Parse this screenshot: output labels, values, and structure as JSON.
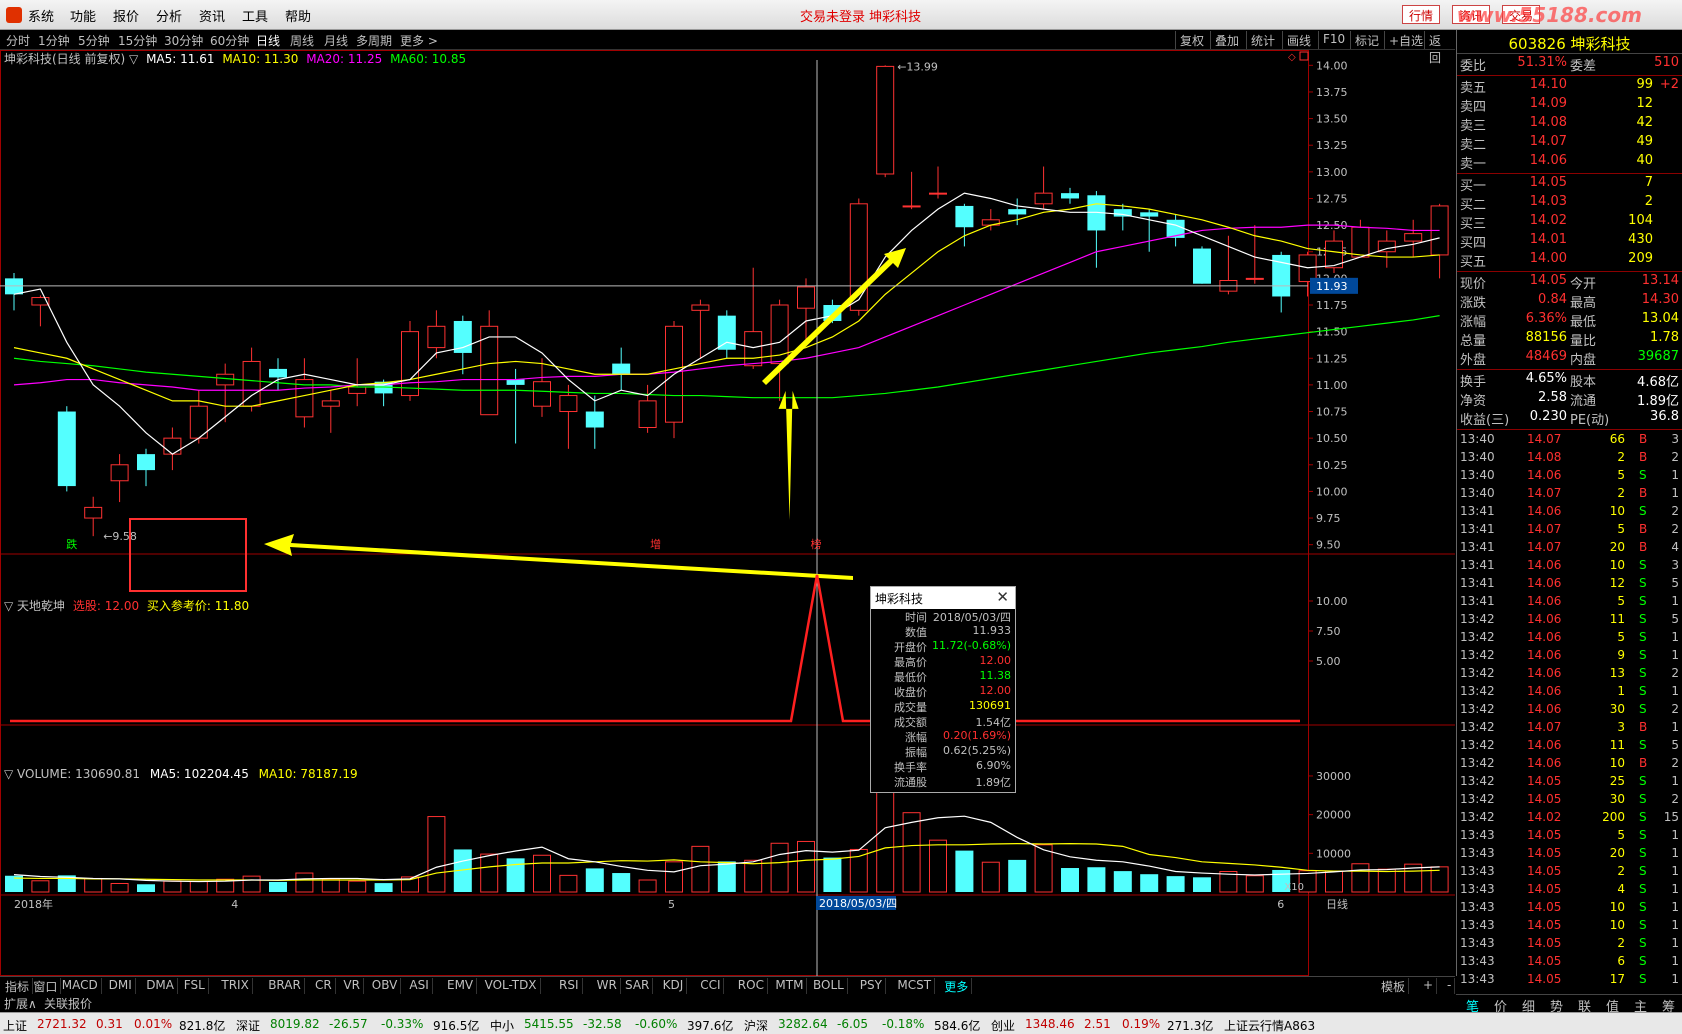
{
  "app": {
    "menu": [
      "系统",
      "功能",
      "报价",
      "分析",
      "资讯",
      "工具",
      "帮助"
    ],
    "center_title": "交易未登录  坤彩科技",
    "right_buttons": [
      "行情",
      "资讯",
      "交易"
    ],
    "watermark": "www.55188.com"
  },
  "toolbar": {
    "periods": [
      "分时",
      "1分钟",
      "5分钟",
      "15分钟",
      "30分钟",
      "60分钟",
      "日线",
      "周线",
      "月线",
      "多周期",
      "更多 >"
    ],
    "active_period": "日线",
    "right_items": [
      "复权",
      "叠加",
      "统计",
      "画线",
      "F10",
      "标记",
      "+自选",
      "返回"
    ]
  },
  "main_chart": {
    "header_name": "坤彩科技(日线 前复权) ▽",
    "ma_labels": [
      {
        "text": "MA5: 11.61",
        "color": "#ffffff"
      },
      {
        "text": "MA10: 11.30",
        "color": "#ffff00"
      },
      {
        "text": "MA20: 11.25",
        "color": "#ff00ff"
      },
      {
        "text": "MA60: 10.85",
        "color": "#00ff00"
      }
    ],
    "y_ticks": [
      "14.00",
      "13.75",
      "13.50",
      "13.25",
      "13.00",
      "12.75",
      "12.50",
      "12.25",
      "12.00",
      "11.75",
      "11.50",
      "11.25",
      "11.00",
      "10.75",
      "10.50",
      "10.25",
      "10.00",
      "9.75",
      "9.50"
    ],
    "y_range": [
      9.45,
      14.05
    ],
    "cursor_price": "11.93",
    "high_label": "13.99",
    "low_label": "9.58",
    "markers": [
      "跌",
      "增",
      "榜"
    ],
    "candles": [
      [
        12.0,
        11.85,
        12.05,
        11.7
      ],
      [
        11.75,
        11.82,
        11.84,
        11.55
      ],
      [
        10.75,
        10.05,
        10.8,
        10.0
      ],
      [
        9.75,
        9.85,
        9.95,
        9.58
      ],
      [
        10.1,
        10.25,
        10.35,
        9.9
      ],
      [
        10.35,
        10.2,
        10.4,
        10.05
      ],
      [
        10.35,
        10.5,
        10.6,
        10.2
      ],
      [
        10.5,
        10.8,
        10.95,
        10.45
      ],
      [
        11.0,
        11.1,
        11.2,
        10.65
      ],
      [
        10.8,
        11.22,
        11.35,
        10.75
      ],
      [
        11.15,
        11.07,
        11.25,
        10.95
      ],
      [
        10.7,
        11.05,
        11.25,
        10.6
      ],
      [
        10.8,
        10.85,
        10.95,
        10.55
      ],
      [
        10.92,
        10.98,
        11.25,
        10.8
      ],
      [
        11.03,
        10.92,
        11.05,
        10.8
      ],
      [
        10.9,
        11.5,
        11.6,
        10.85
      ],
      [
        11.35,
        11.55,
        11.7,
        11.25
      ],
      [
        11.6,
        11.3,
        11.65,
        11.1
      ],
      [
        10.72,
        11.55,
        11.7,
        10.95
      ],
      [
        11.05,
        11.0,
        11.15,
        10.45
      ],
      [
        10.8,
        11.03,
        11.25,
        10.7
      ],
      [
        10.75,
        10.9,
        11.0,
        10.4
      ],
      [
        10.75,
        10.6,
        10.9,
        10.4
      ],
      [
        11.2,
        11.1,
        11.35,
        10.95
      ],
      [
        10.6,
        10.85,
        11.0,
        10.55
      ],
      [
        10.65,
        11.55,
        11.6,
        10.5
      ],
      [
        11.7,
        11.75,
        11.8,
        11.25
      ],
      [
        11.65,
        11.33,
        11.7,
        11.25
      ],
      [
        11.18,
        11.5,
        12.1,
        11.15
      ],
      [
        11.2,
        11.75,
        11.8,
        10.85
      ],
      [
        11.72,
        11.92,
        12.0,
        11.38
      ],
      [
        11.75,
        11.6,
        11.8,
        11.58
      ],
      [
        11.7,
        12.7,
        12.75,
        11.65
      ],
      [
        12.98,
        13.99,
        14.0,
        12.95
      ],
      [
        12.68,
        12.68,
        13.0,
        12.65
      ],
      [
        12.8,
        12.8,
        13.05,
        12.75
      ],
      [
        12.68,
        12.48,
        12.7,
        12.3
      ],
      [
        12.5,
        12.55,
        12.65,
        12.45
      ],
      [
        12.65,
        12.6,
        12.75,
        12.5
      ],
      [
        12.7,
        12.8,
        13.05,
        12.65
      ],
      [
        12.8,
        12.75,
        12.85,
        12.7
      ],
      [
        12.78,
        12.45,
        12.82,
        12.1
      ],
      [
        12.65,
        12.58,
        12.7,
        12.45
      ],
      [
        12.62,
        12.58,
        12.65,
        12.25
      ],
      [
        12.55,
        12.38,
        12.6,
        12.3
      ],
      [
        12.28,
        11.95,
        12.3,
        11.95
      ],
      [
        11.88,
        11.98,
        12.4,
        11.85
      ],
      [
        12.0,
        12.0,
        12.5,
        11.95
      ],
      [
        12.22,
        11.83,
        12.25,
        11.68
      ],
      [
        11.97,
        12.22,
        12.25,
        11.83
      ],
      [
        12.1,
        12.35,
        12.45,
        12.05
      ],
      [
        12.2,
        12.48,
        12.55,
        12.2
      ],
      [
        12.25,
        12.35,
        12.45,
        12.1
      ],
      [
        12.35,
        12.42,
        12.55,
        12.2
      ],
      [
        12.22,
        12.68,
        12.7,
        12.0
      ]
    ],
    "ma5": [
      11.85,
      11.9,
      11.4,
      11.0,
      10.8,
      10.55,
      10.35,
      10.5,
      10.7,
      10.9,
      11.05,
      11.1,
      11.05,
      11.0,
      11.0,
      11.05,
      11.3,
      11.35,
      11.45,
      11.45,
      11.3,
      11.05,
      10.85,
      10.95,
      10.9,
      11.1,
      11.25,
      11.4,
      11.35,
      11.4,
      11.6,
      11.65,
      11.8,
      12.2,
      12.45,
      12.65,
      12.8,
      12.75,
      12.68,
      12.65,
      12.62,
      12.62,
      12.6,
      12.55,
      12.5,
      12.4,
      12.3,
      12.2,
      12.15,
      12.1,
      12.12,
      12.2,
      12.28,
      12.32,
      12.38
    ],
    "ma10": [
      11.35,
      11.3,
      11.25,
      11.15,
      11.05,
      10.95,
      10.85,
      10.85,
      10.8,
      10.8,
      10.85,
      10.9,
      10.95,
      11.0,
      11.02,
      11.05,
      11.1,
      11.15,
      11.2,
      11.22,
      11.2,
      11.15,
      11.1,
      11.1,
      11.1,
      11.15,
      11.2,
      11.25,
      11.25,
      11.28,
      11.35,
      11.45,
      11.6,
      11.85,
      12.05,
      12.25,
      12.4,
      12.5,
      12.55,
      12.62,
      12.65,
      12.7,
      12.68,
      12.65,
      12.6,
      12.55,
      12.48,
      12.4,
      12.35,
      12.28,
      12.25,
      12.22,
      12.2,
      12.2,
      12.22
    ],
    "ma20": [
      11.0,
      11.02,
      11.05,
      11.05,
      11.02,
      11.0,
      10.98,
      10.95,
      10.95,
      10.95,
      10.95,
      10.97,
      10.98,
      11.0,
      11.0,
      11.02,
      11.03,
      11.05,
      11.05,
      11.05,
      11.07,
      11.08,
      11.08,
      11.1,
      11.1,
      11.12,
      11.15,
      11.18,
      11.2,
      11.22,
      11.25,
      11.3,
      11.35,
      11.45,
      11.55,
      11.65,
      11.75,
      11.85,
      11.95,
      12.05,
      12.15,
      12.25,
      12.3,
      12.35,
      12.4,
      12.45,
      12.47,
      12.48,
      12.48,
      12.5,
      12.5,
      12.48,
      12.47,
      12.45,
      12.45
    ],
    "ma60": [
      11.25,
      11.22,
      11.2,
      11.18,
      11.15,
      11.12,
      11.1,
      11.08,
      11.06,
      11.04,
      11.02,
      11.0,
      11.0,
      10.98,
      10.98,
      10.97,
      10.96,
      10.95,
      10.95,
      10.95,
      10.94,
      10.93,
      10.92,
      10.92,
      10.91,
      10.9,
      10.9,
      10.89,
      10.88,
      10.88,
      10.88,
      10.88,
      10.9,
      10.92,
      10.95,
      10.98,
      11.02,
      11.06,
      11.1,
      11.14,
      11.18,
      11.22,
      11.26,
      11.3,
      11.33,
      11.36,
      11.4,
      11.43,
      11.46,
      11.49,
      11.52,
      11.55,
      11.58,
      11.61,
      11.65
    ]
  },
  "indicator_panel": {
    "name": "▽ 天地乾坤",
    "signal_label": "选股: 12.00",
    "buy_price_label": "买入参考价: 11.80",
    "y_ticks": [
      "10.00",
      "7.50",
      "5.00"
    ],
    "peak_index": 30
  },
  "volume_panel": {
    "label_volume": "▽ VOLUME: 130690.81",
    "label_ma5": "MA5: 102204.45",
    "label_ma10": "MA10: 78187.19",
    "y_ticks": [
      "30000",
      "20000",
      "10000"
    ],
    "unit": "X10",
    "volumes": [
      4200,
      2900,
      4300,
      3500,
      2200,
      2000,
      2800,
      2700,
      3300,
      4100,
      2600,
      4900,
      3400,
      2800,
      2300,
      3900,
      19500,
      11000,
      9800,
      8700,
      9500,
      4300,
      6100,
      4900,
      3100,
      7800,
      11800,
      7900,
      8200,
      12600,
      13069,
      8900,
      11000,
      37500,
      20500,
      13400,
      10700,
      7700,
      8300,
      12200,
      6200,
      6400,
      5400,
      4600,
      4100,
      3800,
      5300,
      4200,
      5700,
      5500,
      5400,
      7300,
      5900,
      7200,
      6500
    ],
    "vma5": [
      4500,
      4000,
      3800,
      3500,
      3400,
      3000,
      2800,
      2700,
      2800,
      3100,
      3100,
      3400,
      3500,
      3500,
      3200,
      3400,
      6400,
      8000,
      9400,
      10600,
      11600,
      8600,
      7800,
      6600,
      5600,
      5200,
      6800,
      7200,
      7800,
      9700,
      10700,
      10300,
      10800,
      16600,
      18000,
      19200,
      19600,
      18000,
      14100,
      10900,
      9100,
      8200,
      7800,
      6700,
      5300,
      4900,
      4600,
      4400,
      4600,
      4800,
      5200,
      5700,
      5800,
      6200,
      6500
    ],
    "vma10": [
      3600,
      3500,
      3500,
      3400,
      3400,
      3300,
      3200,
      3100,
      3100,
      3100,
      3000,
      3100,
      3100,
      3100,
      3100,
      3200,
      4900,
      5700,
      6500,
      7100,
      7500,
      7500,
      7800,
      8100,
      8000,
      8300,
      7800,
      7600,
      7300,
      7600,
      8200,
      8500,
      9200,
      11400,
      12000,
      12200,
      12200,
      12400,
      12500,
      12400,
      12500,
      12400,
      11800,
      9700,
      8900,
      7800,
      7400,
      7000,
      6400,
      5600,
      5400,
      5400,
      5300,
      5400,
      5600
    ],
    "x_labels": [
      "2018年",
      "4",
      "5",
      "2018/05/03/四",
      "6"
    ]
  },
  "popup": {
    "title": "坤彩科技",
    "rows": [
      {
        "k": "时间",
        "v": "2018/05/03/四",
        "c": "#c0c0c0"
      },
      {
        "k": "数值",
        "v": "11.933",
        "c": "#c0c0c0"
      },
      {
        "k": "开盘价",
        "v": "11.72(-0.68%)",
        "c": "#00ff00"
      },
      {
        "k": "最高价",
        "v": "12.00",
        "c": "#ff3030"
      },
      {
        "k": "最低价",
        "v": "11.38",
        "c": "#00ff00"
      },
      {
        "k": "收盘价",
        "v": "12.00",
        "c": "#ff3030"
      },
      {
        "k": "成交量",
        "v": "130691",
        "c": "#ffff00"
      },
      {
        "k": "成交额",
        "v": "1.54亿",
        "c": "#c0c0c0"
      },
      {
        "k": "涨幅",
        "v": "0.20(1.69%)",
        "c": "#ff3030"
      },
      {
        "k": "振幅",
        "v": "0.62(5.25%)",
        "c": "#c0c0c0"
      },
      {
        "k": "换手率",
        "v": "6.90%",
        "c": "#c0c0c0"
      },
      {
        "k": "流通股",
        "v": "1.89亿",
        "c": "#c0c0c0"
      }
    ]
  },
  "quote": {
    "title": "603826 坤彩科技",
    "weibi": {
      "a": "委比",
      "b": "51.31%",
      "c": "委差",
      "d": "510"
    },
    "sell": [
      {
        "a": "卖五",
        "b": "14.10",
        "d": "99",
        "e": "+2"
      },
      {
        "a": "卖四",
        "b": "14.09",
        "d": "12",
        "e": ""
      },
      {
        "a": "卖三",
        "b": "14.08",
        "d": "42",
        "e": ""
      },
      {
        "a": "卖二",
        "b": "14.07",
        "d": "49",
        "e": ""
      },
      {
        "a": "卖一",
        "b": "14.06",
        "d": "40",
        "e": ""
      }
    ],
    "buy": [
      {
        "a": "买一",
        "b": "14.05",
        "d": "7"
      },
      {
        "a": "买二",
        "b": "14.03",
        "d": "2"
      },
      {
        "a": "买三",
        "b": "14.02",
        "d": "104"
      },
      {
        "a": "买四",
        "b": "14.01",
        "d": "430"
      },
      {
        "a": "买五",
        "b": "14.00",
        "d": "209"
      }
    ],
    "stats": [
      {
        "a": "现价",
        "b": "14.05",
        "bc": "#ff3030",
        "c": "今开",
        "d": "13.14",
        "dc": "#ff3030"
      },
      {
        "a": "涨跌",
        "b": "0.84",
        "bc": "#ff3030",
        "c": "最高",
        "d": "14.30",
        "dc": "#ff3030"
      },
      {
        "a": "涨幅",
        "b": "6.36%",
        "bc": "#ff3030",
        "c": "最低",
        "d": "13.04",
        "dc": "#ffff00"
      },
      {
        "a": "总量",
        "b": "88156",
        "bc": "#ffff00",
        "c": "量比",
        "d": "1.78",
        "dc": "#ffff00"
      },
      {
        "a": "外盘",
        "b": "48469",
        "bc": "#ff3030",
        "c": "内盘",
        "d": "39687",
        "dc": "#00ff00"
      },
      {
        "a": "换手",
        "b": "4.65%",
        "bc": "#ffffff",
        "c": "股本",
        "d": "4.68亿",
        "dc": "#ffffff"
      },
      {
        "a": "净资",
        "b": "2.58",
        "bc": "#ffffff",
        "c": "流通",
        "d": "1.89亿",
        "dc": "#ffffff"
      },
      {
        "a": "收益(三)",
        "b": "0.230",
        "bc": "#ffffff",
        "c": "PE(动)",
        "d": "36.8",
        "dc": "#ffffff"
      }
    ],
    "ticks": [
      [
        "13:40",
        "14.07",
        "66",
        "B",
        "3"
      ],
      [
        "13:40",
        "14.08",
        "2",
        "B",
        "2"
      ],
      [
        "13:40",
        "14.06",
        "5",
        "S",
        "1"
      ],
      [
        "13:40",
        "14.07",
        "2",
        "B",
        "1"
      ],
      [
        "13:41",
        "14.06",
        "10",
        "S",
        "2"
      ],
      [
        "13:41",
        "14.07",
        "5",
        "B",
        "2"
      ],
      [
        "13:41",
        "14.07",
        "20",
        "B",
        "4"
      ],
      [
        "13:41",
        "14.06",
        "10",
        "S",
        "3"
      ],
      [
        "13:41",
        "14.06",
        "12",
        "S",
        "5"
      ],
      [
        "13:41",
        "14.06",
        "5",
        "S",
        "1"
      ],
      [
        "13:42",
        "14.06",
        "11",
        "S",
        "5"
      ],
      [
        "13:42",
        "14.06",
        "5",
        "S",
        "1"
      ],
      [
        "13:42",
        "14.06",
        "9",
        "S",
        "1"
      ],
      [
        "13:42",
        "14.06",
        "13",
        "S",
        "2"
      ],
      [
        "13:42",
        "14.06",
        "1",
        "S",
        "1"
      ],
      [
        "13:42",
        "14.06",
        "30",
        "S",
        "2"
      ],
      [
        "13:42",
        "14.07",
        "3",
        "B",
        "1"
      ],
      [
        "13:42",
        "14.06",
        "11",
        "S",
        "5"
      ],
      [
        "13:42",
        "14.06",
        "10",
        "B",
        "2"
      ],
      [
        "13:42",
        "14.05",
        "25",
        "S",
        "1"
      ],
      [
        "13:42",
        "14.05",
        "30",
        "S",
        "2"
      ],
      [
        "13:42",
        "14.02",
        "200",
        "S",
        "15"
      ],
      [
        "13:43",
        "14.05",
        "5",
        "S",
        "1"
      ],
      [
        "13:43",
        "14.05",
        "20",
        "S",
        "1"
      ],
      [
        "13:43",
        "14.05",
        "2",
        "S",
        "1"
      ],
      [
        "13:43",
        "14.05",
        "4",
        "S",
        "1"
      ],
      [
        "13:43",
        "14.05",
        "10",
        "S",
        "1"
      ],
      [
        "13:43",
        "14.05",
        "10",
        "S",
        "1"
      ],
      [
        "13:43",
        "14.05",
        "2",
        "S",
        "1"
      ],
      [
        "13:43",
        "14.05",
        "6",
        "S",
        "1"
      ],
      [
        "13:43",
        "14.05",
        "17",
        "S",
        "1"
      ]
    ],
    "bottom_tabs": [
      "笔",
      "价",
      "细",
      "势",
      "联",
      "值",
      "主",
      "筹"
    ]
  },
  "bottom": {
    "indicators": [
      "指标",
      "窗口",
      "MACD",
      "DMI",
      "DMA",
      "FSL",
      "TRIX",
      "BRAR",
      "CR",
      "VR",
      "OBV",
      "ASI",
      "EMV",
      "VOL-TDX",
      "RSI",
      "WR",
      "SAR",
      "KDJ",
      "CCI",
      "ROC",
      "MTM",
      "BOLL",
      "PSY",
      "MCST",
      "更多"
    ],
    "right": [
      "模板",
      "+",
      "-"
    ],
    "sub": [
      "扩展∧",
      "关联报价"
    ],
    "x_right": "日线"
  },
  "status": [
    {
      "t": "上证",
      "c": "#000"
    },
    {
      "t": "2721.32",
      "c": "#c00000"
    },
    {
      "t": "0.31",
      "c": "#c00000"
    },
    {
      "t": "0.01%",
      "c": "#c00000"
    },
    {
      "t": "821.8亿",
      "c": "#000"
    },
    {
      "t": "深证",
      "c": "#000"
    },
    {
      "t": "8019.82",
      "c": "#008000"
    },
    {
      "t": "-26.57",
      "c": "#008000"
    },
    {
      "t": "-0.33%",
      "c": "#008000"
    },
    {
      "t": "916.5亿",
      "c": "#000"
    },
    {
      "t": "中小",
      "c": "#000"
    },
    {
      "t": "5415.55",
      "c": "#008000"
    },
    {
      "t": "-32.58",
      "c": "#008000"
    },
    {
      "t": "-0.60%",
      "c": "#008000"
    },
    {
      "t": "397.6亿",
      "c": "#000"
    },
    {
      "t": "沪深",
      "c": "#000"
    },
    {
      "t": "3282.64",
      "c": "#008000"
    },
    {
      "t": "-6.05",
      "c": "#008000"
    },
    {
      "t": "-0.18%",
      "c": "#008000"
    },
    {
      "t": "584.6亿",
      "c": "#000"
    },
    {
      "t": "创业",
      "c": "#000"
    },
    {
      "t": "1348.46",
      "c": "#c00000"
    },
    {
      "t": "2.51",
      "c": "#c00000"
    },
    {
      "t": "0.19%",
      "c": "#c00000"
    },
    {
      "t": "271.3亿",
      "c": "#000"
    },
    {
      "t": "上证云行情A863",
      "c": "#000"
    }
  ],
  "colors": {
    "up": "#ff3232",
    "down": "#54ffff",
    "ma5": "#ffffff",
    "ma10": "#ffff00",
    "ma20": "#ff00ff",
    "ma60": "#00ff00",
    "arrow": "#ffff00"
  }
}
